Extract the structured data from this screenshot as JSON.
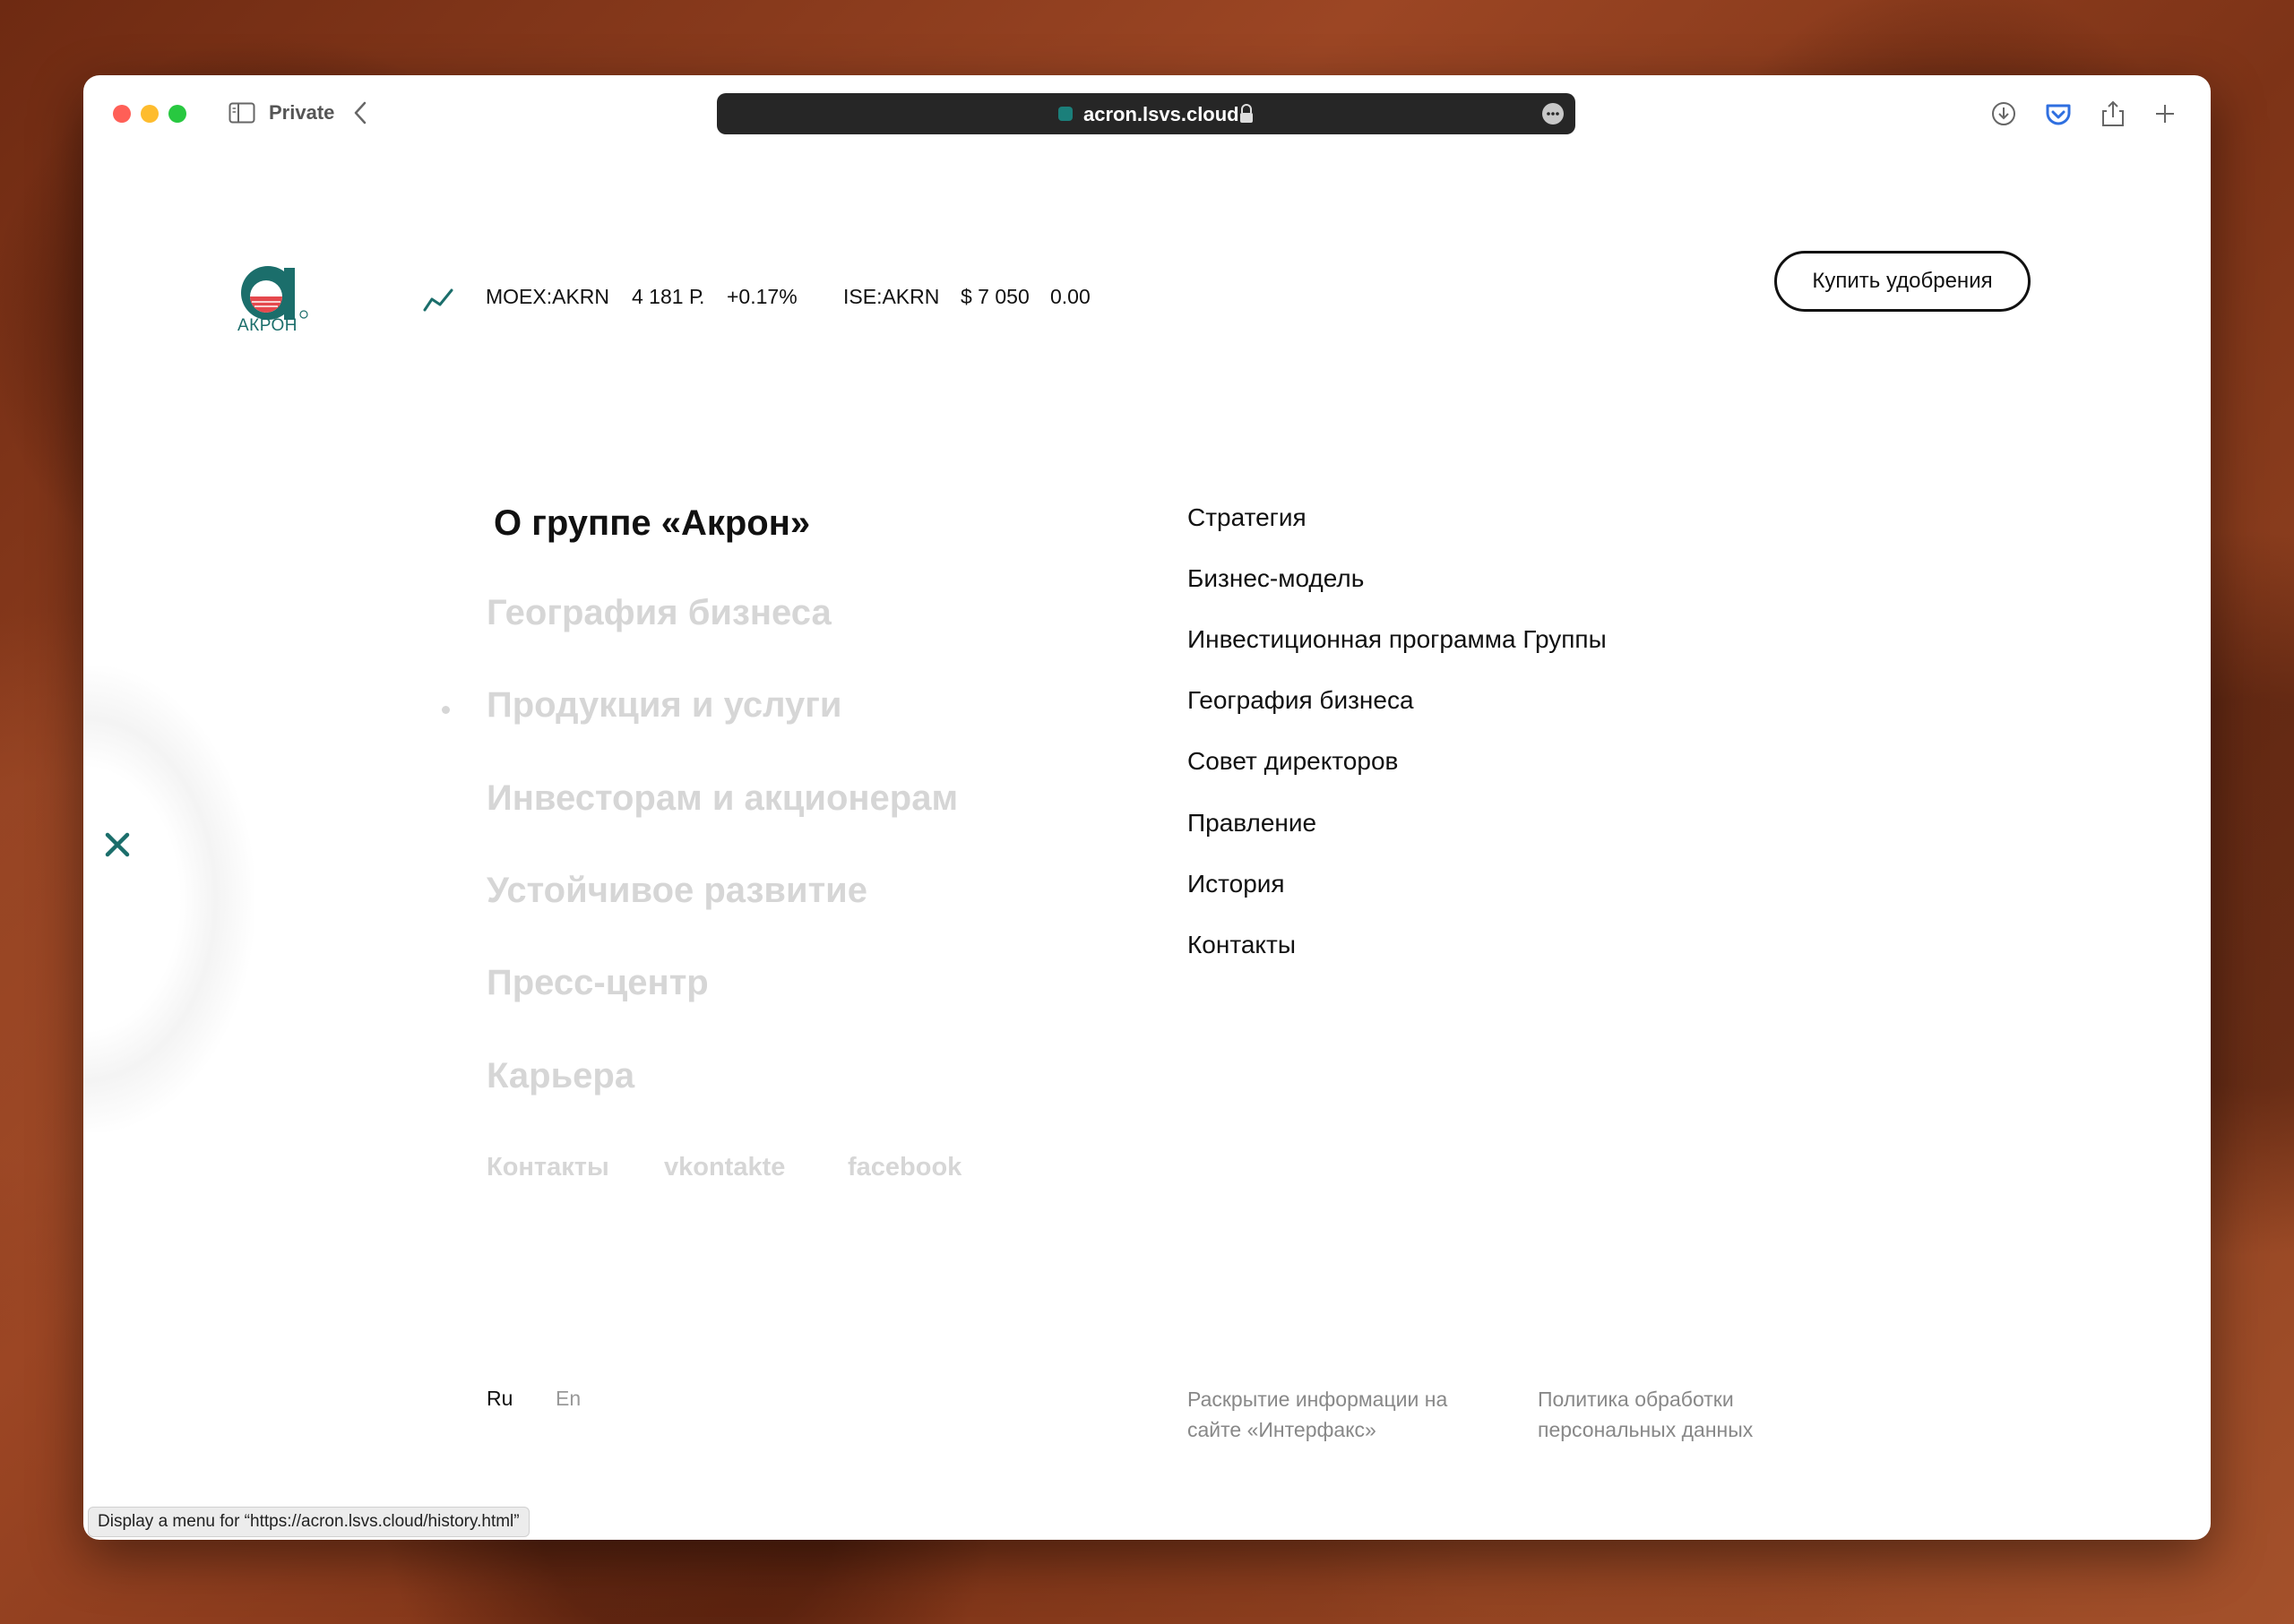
{
  "browser": {
    "private_label": "Private",
    "url": "acron.lsvs.cloud",
    "status_text": "Display a menu for “https://acron.lsvs.cloud/history.html”"
  },
  "header": {
    "logo_text": "АКРОН",
    "tickers": [
      {
        "symbol": "MOEX:AKRN",
        "price": "4 181 Р.",
        "change": "+0.17%"
      },
      {
        "symbol": "ISE:AKRN",
        "price": "$ 7 050",
        "change": "0.00"
      }
    ],
    "buy_button": "Купить удобрения"
  },
  "menu": {
    "title": "О группе «Акрон»",
    "items": [
      "География бизнеса",
      "Продукция и услуги",
      "Инвесторам и акционерам",
      "Устойчивое развитие",
      "Пресс-центр",
      "Карьера"
    ],
    "small_links": [
      "Контакты",
      "vkontakte",
      "facebook"
    ],
    "sub_items": [
      "Стратегия",
      "Бизнес-модель",
      "Инвестиционная программа Группы",
      "География бизнеса",
      "Совет директоров",
      "Правление",
      "История",
      "Контакты"
    ]
  },
  "footer": {
    "lang_ru": "Ru",
    "lang_en": "En",
    "disclosure": "Раскрытие информации на сайте «Интерфакс»",
    "privacy": "Политика обработки персональных данных"
  },
  "colors": {
    "brand": "#1b6e6b",
    "inactive": "#d6d6d6"
  }
}
